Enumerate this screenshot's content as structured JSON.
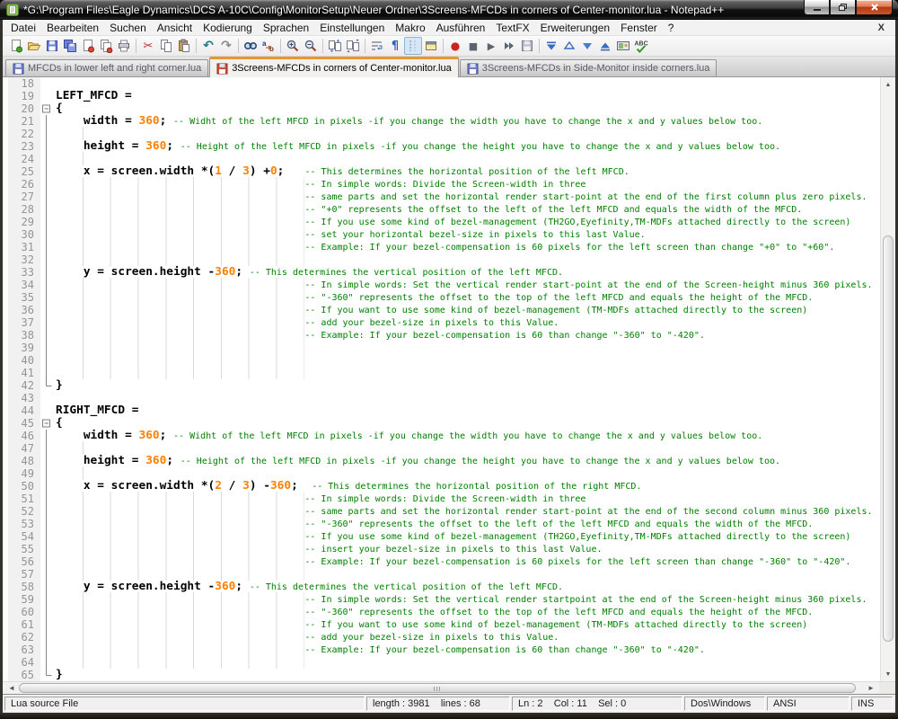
{
  "window": {
    "title": "*G:\\Program Files\\Eagle Dynamics\\DCS A-10C\\Config\\MonitorSetup\\Neuer Ordner\\3Screens-MFCDs in corners of Center-monitor.lua - Notepad++"
  },
  "menu": {
    "items": [
      "Datei",
      "Bearbeiten",
      "Suchen",
      "Ansicht",
      "Kodierung",
      "Sprachen",
      "Einstellungen",
      "Makro",
      "Ausführen",
      "TextFX",
      "Erweiterungen",
      "Fenster",
      "?"
    ],
    "close_label": "X"
  },
  "toolbar": {
    "groups": [
      [
        "new-file",
        "open-file",
        "save",
        "save-all",
        "close",
        "close-all",
        "print"
      ],
      [
        "cut",
        "copy",
        "paste"
      ],
      [
        "undo",
        "redo"
      ],
      [
        "find",
        "replace"
      ],
      [
        "zoom-in",
        "zoom-out"
      ],
      [
        "sync-vertical",
        "sync-horizontal"
      ],
      [
        "word-wrap",
        "show-all-characters",
        "indent-guide",
        "user-defined-dialog"
      ],
      [
        "record-macro",
        "stop-macro",
        "play-macro",
        "run-macro-multiple",
        "save-macro"
      ],
      [
        "nav-first",
        "nav-prev",
        "nav-next",
        "nav-last",
        "panels",
        "spell-check"
      ]
    ],
    "pressed": "indent-guide"
  },
  "tabs": [
    {
      "label": "MFCDs in lower left and right corner.lua",
      "state": "saved",
      "active": false
    },
    {
      "label": "3Screens-MFCDs in corners of Center-monitor.lua",
      "state": "modified",
      "active": true
    },
    {
      "label": "3Screens-MFCDs in Side-Monitor inside corners.lua",
      "state": "saved",
      "active": false
    }
  ],
  "editor": {
    "first_line": 18,
    "lines": [
      {
        "n": 18,
        "f": "",
        "s": []
      },
      {
        "n": 19,
        "f": "",
        "s": [
          [
            "k",
            "LEFT_MFCD ="
          ]
        ]
      },
      {
        "n": 20,
        "f": "o",
        "s": [
          [
            "k",
            "{"
          ]
        ]
      },
      {
        "n": 21,
        "f": "l",
        "s": [
          [
            "w",
            "    "
          ],
          [
            "k",
            "width"
          ],
          [
            "k",
            " = "
          ],
          [
            "n",
            "360"
          ],
          [
            "k",
            "; "
          ],
          [
            "c",
            "-- Widht of the left MFCD in pixels -if you change the width you have to change the x and y values below too."
          ]
        ]
      },
      {
        "n": 22,
        "f": "l",
        "s": [
          [
            "g",
            "    "
          ]
        ]
      },
      {
        "n": 23,
        "f": "l",
        "s": [
          [
            "w",
            "    "
          ],
          [
            "k",
            "height"
          ],
          [
            "k",
            " = "
          ],
          [
            "n",
            "360"
          ],
          [
            "k",
            "; "
          ],
          [
            "c",
            "-- Height of the left MFCD in pixels -if you change the height you have to change the x and y values below too."
          ]
        ]
      },
      {
        "n": 24,
        "f": "l",
        "s": [
          [
            "g",
            "    "
          ]
        ]
      },
      {
        "n": 25,
        "f": "l",
        "s": [
          [
            "w",
            "    "
          ],
          [
            "k",
            "x"
          ],
          [
            "k",
            " = "
          ],
          [
            "k",
            "screen.width"
          ],
          [
            "k",
            " *("
          ],
          [
            "n",
            "1"
          ],
          [
            "k",
            " / "
          ],
          [
            "n",
            "3"
          ],
          [
            "k",
            ") +"
          ],
          [
            "n",
            "0"
          ],
          [
            "k",
            ";"
          ],
          [
            "w",
            "   "
          ],
          [
            "c",
            "-- This determines the horizontal position of the left MFCD."
          ]
        ]
      },
      {
        "n": 26,
        "f": "l",
        "s": [
          [
            "g",
            "                                    "
          ],
          [
            "c",
            "-- In simple words: Divide the Screen-width in three"
          ]
        ]
      },
      {
        "n": 27,
        "f": "l",
        "s": [
          [
            "g",
            "                                    "
          ],
          [
            "c",
            "-- same parts and set the horizontal render start-point at the end of the first column plus zero pixels."
          ]
        ]
      },
      {
        "n": 28,
        "f": "l",
        "s": [
          [
            "g",
            "                                    "
          ],
          [
            "c",
            "-- \"+0\" represents the offset to the left of the left MFCD and equals the width of the MFCD."
          ]
        ]
      },
      {
        "n": 29,
        "f": "l",
        "s": [
          [
            "g",
            "                                    "
          ],
          [
            "c",
            "-- If you use some kind of bezel-management (TH2GO,Eyefinity,TM-MDFs attached directly to the screen)"
          ]
        ]
      },
      {
        "n": 30,
        "f": "l",
        "s": [
          [
            "g",
            "                                    "
          ],
          [
            "c",
            "-- set your horizontal bezel-size in pixels to this last Value."
          ]
        ]
      },
      {
        "n": 31,
        "f": "l",
        "s": [
          [
            "g",
            "                                    "
          ],
          [
            "c",
            "-- Example: If your bezel-compensation is 60 pixels for the left screen than change \"+0\" to \"+60\"."
          ]
        ]
      },
      {
        "n": 32,
        "f": "l",
        "s": [
          [
            "g",
            "                                    "
          ]
        ]
      },
      {
        "n": 33,
        "f": "l",
        "s": [
          [
            "w",
            "    "
          ],
          [
            "k",
            "y"
          ],
          [
            "k",
            " = "
          ],
          [
            "k",
            "screen.height"
          ],
          [
            "k",
            " -"
          ],
          [
            "n",
            "360"
          ],
          [
            "k",
            "; "
          ],
          [
            "c",
            "-- This determines the vertical position of the left MFCD."
          ]
        ]
      },
      {
        "n": 34,
        "f": "l",
        "s": [
          [
            "g",
            "                                    "
          ],
          [
            "c",
            "-- In simple words: Set the vertical render start-point at the end of the Screen-height minus 360 pixels."
          ]
        ]
      },
      {
        "n": 35,
        "f": "l",
        "s": [
          [
            "g",
            "                                    "
          ],
          [
            "c",
            "-- \"-360\" represents the offset to the top of the left MFCD and equals the height of the MFCD."
          ]
        ]
      },
      {
        "n": 36,
        "f": "l",
        "s": [
          [
            "g",
            "                                    "
          ],
          [
            "c",
            "-- If you want to use some kind of bezel-management (TM-MDFs attached directly to the screen)"
          ]
        ]
      },
      {
        "n": 37,
        "f": "l",
        "s": [
          [
            "g",
            "                                    "
          ],
          [
            "c",
            "-- add your bezel-size in pixels to this Value."
          ]
        ]
      },
      {
        "n": 38,
        "f": "l",
        "s": [
          [
            "g",
            "                                    "
          ],
          [
            "c",
            "-- Example: If your bezel-compensation is 60 than change \"-360\" to \"-420\"."
          ]
        ]
      },
      {
        "n": 39,
        "f": "l",
        "s": [
          [
            "g",
            "                                    "
          ]
        ]
      },
      {
        "n": 40,
        "f": "l",
        "s": [
          [
            "g",
            "                                    "
          ]
        ]
      },
      {
        "n": 41,
        "f": "l",
        "s": [
          [
            "g",
            "                                    "
          ]
        ]
      },
      {
        "n": 42,
        "f": "e",
        "s": [
          [
            "k",
            "}"
          ]
        ]
      },
      {
        "n": 43,
        "f": "",
        "s": []
      },
      {
        "n": 44,
        "f": "",
        "s": [
          [
            "k",
            "RIGHT_MFCD ="
          ]
        ]
      },
      {
        "n": 45,
        "f": "o",
        "s": [
          [
            "k",
            "{"
          ]
        ]
      },
      {
        "n": 46,
        "f": "l",
        "s": [
          [
            "w",
            "    "
          ],
          [
            "k",
            "width"
          ],
          [
            "k",
            " = "
          ],
          [
            "n",
            "360"
          ],
          [
            "k",
            "; "
          ],
          [
            "c",
            "-- Widht of the left MFCD in pixels -if you change the width you have to change the x and y values below too."
          ]
        ]
      },
      {
        "n": 47,
        "f": "l",
        "s": [
          [
            "g",
            "    "
          ]
        ]
      },
      {
        "n": 48,
        "f": "l",
        "s": [
          [
            "w",
            "    "
          ],
          [
            "k",
            "height"
          ],
          [
            "k",
            " = "
          ],
          [
            "n",
            "360"
          ],
          [
            "k",
            "; "
          ],
          [
            "c",
            "-- Height of the left MFCD in pixels -if you change the height you have to change the x and y values below too."
          ]
        ]
      },
      {
        "n": 49,
        "f": "l",
        "s": [
          [
            "g",
            "    "
          ]
        ]
      },
      {
        "n": 50,
        "f": "l",
        "s": [
          [
            "w",
            "    "
          ],
          [
            "k",
            "x"
          ],
          [
            "k",
            " = "
          ],
          [
            "k",
            "screen.width"
          ],
          [
            "k",
            " *("
          ],
          [
            "n",
            "2"
          ],
          [
            "k",
            " / "
          ],
          [
            "n",
            "3"
          ],
          [
            "k",
            ") -"
          ],
          [
            "n",
            "360"
          ],
          [
            "k",
            ";"
          ],
          [
            "w",
            "  "
          ],
          [
            "c",
            "-- This determines the horizontal position of the right MFCD."
          ]
        ]
      },
      {
        "n": 51,
        "f": "l",
        "s": [
          [
            "g",
            "                                    "
          ],
          [
            "c",
            "-- In simple words: Divide the Screen-width in three"
          ]
        ]
      },
      {
        "n": 52,
        "f": "l",
        "s": [
          [
            "g",
            "                                    "
          ],
          [
            "c",
            "-- same parts and set the horizontal render start-point at the end of the second column minus 360 pixels."
          ]
        ]
      },
      {
        "n": 53,
        "f": "l",
        "s": [
          [
            "g",
            "                                    "
          ],
          [
            "c",
            "-- \"-360\" represents the offset to the left of the left MFCD and equals the width of the MFCD."
          ]
        ]
      },
      {
        "n": 54,
        "f": "l",
        "s": [
          [
            "g",
            "                                    "
          ],
          [
            "c",
            "-- If you use some kind of bezel-management (TH2GO,Eyefinity,TM-MDFs attached directly to the screen)"
          ]
        ]
      },
      {
        "n": 55,
        "f": "l",
        "s": [
          [
            "g",
            "                                    "
          ],
          [
            "c",
            "-- insert your bezel-size in pixels to this last Value."
          ]
        ]
      },
      {
        "n": 56,
        "f": "l",
        "s": [
          [
            "g",
            "                                    "
          ],
          [
            "c",
            "-- Example: If your bezel-compensation is 60 pixels for the left screen than change \"-360\" to \"-420\"."
          ]
        ]
      },
      {
        "n": 57,
        "f": "l",
        "s": [
          [
            "g",
            "                                    "
          ]
        ]
      },
      {
        "n": 58,
        "f": "l",
        "s": [
          [
            "w",
            "    "
          ],
          [
            "k",
            "y"
          ],
          [
            "k",
            " = "
          ],
          [
            "k",
            "screen.height"
          ],
          [
            "k",
            " -"
          ],
          [
            "n",
            "360"
          ],
          [
            "k",
            "; "
          ],
          [
            "c",
            "-- This determines the vertical position of the left MFCD."
          ]
        ]
      },
      {
        "n": 59,
        "f": "l",
        "s": [
          [
            "g",
            "                                    "
          ],
          [
            "c",
            "-- In simple words: Set the vertical render startpoint at the end of the Screen-height minus 360 pixels."
          ]
        ]
      },
      {
        "n": 60,
        "f": "l",
        "s": [
          [
            "g",
            "                                    "
          ],
          [
            "c",
            "-- \"-360\" represents the offset to the top of the left MFCD and equals the height of the MFCD."
          ]
        ]
      },
      {
        "n": 61,
        "f": "l",
        "s": [
          [
            "g",
            "                                    "
          ],
          [
            "c",
            "-- If you want to use some kind of bezel-management (TM-MDFs attached directly to the screen)"
          ]
        ]
      },
      {
        "n": 62,
        "f": "l",
        "s": [
          [
            "g",
            "                                    "
          ],
          [
            "c",
            "-- add your bezel-size in pixels to this Value."
          ]
        ]
      },
      {
        "n": 63,
        "f": "l",
        "s": [
          [
            "g",
            "                                    "
          ],
          [
            "c",
            "-- Example: If your bezel-compensation is 60 than change \"-360\" to \"-420\"."
          ]
        ]
      },
      {
        "n": 64,
        "f": "l",
        "s": [
          [
            "g",
            "                                    "
          ]
        ]
      },
      {
        "n": 65,
        "f": "e",
        "s": [
          [
            "k",
            "}"
          ]
        ]
      }
    ]
  },
  "status": {
    "doc_type": "Lua source File",
    "length_info": "length : 3981    lines : 68",
    "cursor_info": "Ln : 2    Col : 11    Sel : 0",
    "eol": "Dos\\Windows",
    "encoding": "ANSI",
    "insert_mode": "INS"
  },
  "colors": {
    "accent_tab": "#e8962e",
    "comment": "#008000",
    "number": "#ff8000",
    "modified_icon": "#d04c38",
    "saved_icon": "#7280cc"
  }
}
